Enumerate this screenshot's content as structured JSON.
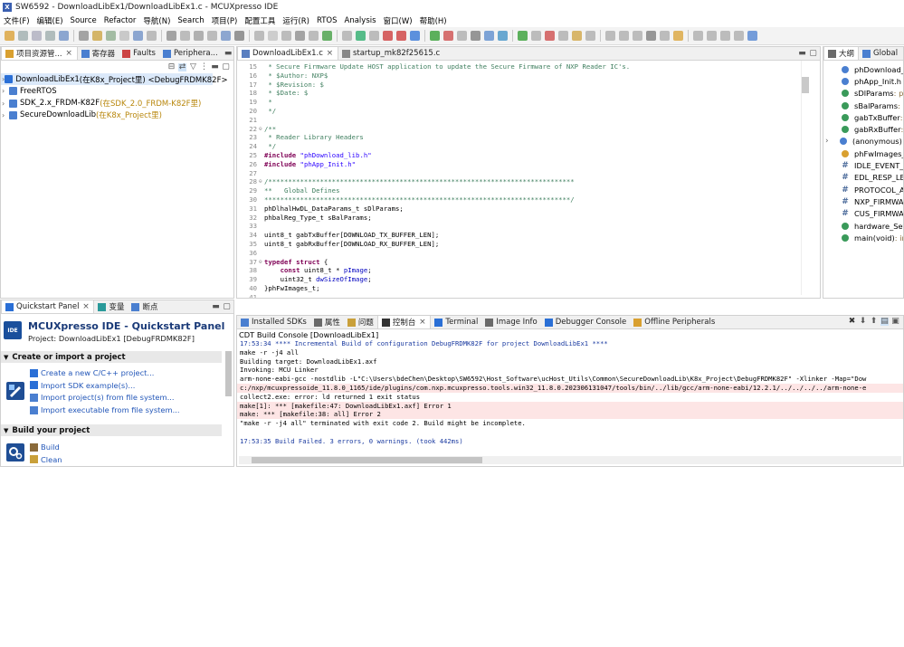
{
  "window": {
    "title": "SW6592 - DownloadLibEx1/DownloadLibEx1.c - MCUXpresso IDE"
  },
  "menu": [
    "文件(F)",
    "编辑(E)",
    "Source",
    "Refactor",
    "导航(N)",
    "Search",
    "项目(P)",
    "配置工具",
    "运行(R)",
    "RTOS",
    "Analysis",
    "窗口(W)",
    "帮助(H)"
  ],
  "explorer": {
    "tabs": [
      "项目资源管...",
      "寄存器",
      "Faults",
      "Periphera..."
    ],
    "items": [
      {
        "name": "DownloadLibEx1",
        "suffix": " (在K8x_Project里) <DebugFRDMK82F>"
      },
      {
        "name": "FreeRTOS",
        "suffix": ""
      },
      {
        "name": "SDK_2.x_FRDM-K82F",
        "suffix": " (在SDK_2.0_FRDM-K82F里)"
      },
      {
        "name": "SecureDownloadLib",
        "suffix": " (在K8x_Project里)"
      }
    ]
  },
  "editor": {
    "tabs": [
      "DownloadLibEx1.c",
      "startup_mk82f25615.c"
    ],
    "lines": [
      {
        "n": "15",
        "fold": "",
        "parts": [
          [
            "cm",
            " * Secure Firmware Update HOST application to update the Secure Firmware of NXP Reader IC's."
          ]
        ]
      },
      {
        "n": "16",
        "fold": "",
        "parts": [
          [
            "cm",
            " * $Author: NXP$"
          ]
        ]
      },
      {
        "n": "17",
        "fold": "",
        "parts": [
          [
            "cm",
            " * $Revision: $"
          ]
        ]
      },
      {
        "n": "18",
        "fold": "",
        "parts": [
          [
            "cm",
            " * $Date: $"
          ]
        ]
      },
      {
        "n": "19",
        "fold": "",
        "parts": [
          [
            "cm",
            " *"
          ]
        ]
      },
      {
        "n": "20",
        "fold": "",
        "parts": [
          [
            "cm",
            " */"
          ]
        ]
      },
      {
        "n": "21",
        "fold": "",
        "parts": [
          [
            "tx",
            ""
          ]
        ]
      },
      {
        "n": "22",
        "fold": "⊖",
        "parts": [
          [
            "cm",
            "/**"
          ]
        ]
      },
      {
        "n": "23",
        "fold": "",
        "parts": [
          [
            "cm",
            " * Reader Library Headers"
          ]
        ]
      },
      {
        "n": "24",
        "fold": "",
        "parts": [
          [
            "cm",
            " */"
          ]
        ]
      },
      {
        "n": "25",
        "fold": "",
        "parts": [
          [
            "kw",
            "#include "
          ],
          [
            "str",
            "\"phDownload_lib.h\""
          ]
        ]
      },
      {
        "n": "26",
        "fold": "",
        "parts": [
          [
            "kw",
            "#include "
          ],
          [
            "str",
            "\"phApp_Init.h\""
          ]
        ]
      },
      {
        "n": "27",
        "fold": "",
        "parts": [
          [
            "tx",
            ""
          ]
        ]
      },
      {
        "n": "28",
        "fold": "⊖",
        "parts": [
          [
            "cm",
            "/*****************************************************************************"
          ]
        ]
      },
      {
        "n": "29",
        "fold": "",
        "parts": [
          [
            "cm",
            "**   Global Defines"
          ]
        ]
      },
      {
        "n": "30",
        "fold": "",
        "parts": [
          [
            "cm",
            "*****************************************************************************/"
          ]
        ]
      },
      {
        "n": "31",
        "fold": "",
        "parts": [
          [
            "tx",
            "phDlhalHwDL_DataParams_t sDlParams;"
          ]
        ]
      },
      {
        "n": "32",
        "fold": "",
        "parts": [
          [
            "tx",
            "phbalReg_Type_t sBalParams;"
          ]
        ]
      },
      {
        "n": "33",
        "fold": "",
        "parts": [
          [
            "tx",
            ""
          ]
        ]
      },
      {
        "n": "34",
        "fold": "",
        "parts": [
          [
            "tx",
            "uint8_t gabTxBuffer[DOWNLOAD_TX_BUFFER_LEN];"
          ]
        ]
      },
      {
        "n": "35",
        "fold": "",
        "parts": [
          [
            "tx",
            "uint8_t gabRxBuffer[DOWNLOAD_RX_BUFFER_LEN];"
          ]
        ]
      },
      {
        "n": "36",
        "fold": "",
        "parts": [
          [
            "tx",
            ""
          ]
        ]
      },
      {
        "n": "37",
        "fold": "⊖",
        "parts": [
          [
            "kw",
            "typedef struct"
          ],
          [
            "tx",
            " {"
          ]
        ]
      },
      {
        "n": "38",
        "fold": "",
        "parts": [
          [
            "tx",
            "    "
          ],
          [
            "kw",
            "const"
          ],
          [
            "tx",
            " uint8_t * "
          ],
          [
            "fld",
            "pImage"
          ],
          [
            "tx",
            ";"
          ]
        ]
      },
      {
        "n": "39",
        "fold": "",
        "parts": [
          [
            "tx",
            "    uint32_t "
          ],
          [
            "fld",
            "dwSizeOfImage"
          ],
          [
            "tx",
            ";"
          ]
        ]
      },
      {
        "n": "40",
        "fold": "",
        "parts": [
          [
            "tx",
            "}phFwImages_t;"
          ]
        ]
      },
      {
        "n": "41",
        "fold": "",
        "parts": [
          [
            "tx",
            ""
          ]
        ]
      }
    ]
  },
  "outline": {
    "tabs": [
      "大纲",
      "Global"
    ],
    "items": [
      {
        "kind": "include",
        "name": "phDownload_li",
        "type": ""
      },
      {
        "kind": "include",
        "name": "phApp_Init.h",
        "type": ""
      },
      {
        "kind": "var",
        "name": "sDlParams",
        "type": " : ph"
      },
      {
        "kind": "var",
        "name": "sBalParams",
        "type": " : p"
      },
      {
        "kind": "var",
        "name": "gabTxBuffer",
        "type": " : u"
      },
      {
        "kind": "var",
        "name": "gabRxBuffer",
        "type": " : u"
      },
      {
        "kind": "anon",
        "name": "(anonymous)",
        "type": ""
      },
      {
        "kind": "type",
        "name": "phFwImages_t",
        "type": ""
      },
      {
        "kind": "macro",
        "name": "IDLE_EVENT_R",
        "type": ""
      },
      {
        "kind": "macro",
        "name": "EDL_RESP_LEN",
        "type": ""
      },
      {
        "kind": "macro",
        "name": "PROTOCOL_AR",
        "type": ""
      },
      {
        "kind": "macro",
        "name": "NXP_FIRMWAR",
        "type": ""
      },
      {
        "kind": "macro",
        "name": "CUS_FIRMWAR",
        "type": ""
      },
      {
        "kind": "func",
        "name": "hardware_Setu",
        "type": ""
      },
      {
        "kind": "func",
        "name": "main(void)",
        "type": " : int"
      }
    ]
  },
  "quickstart": {
    "tabs": [
      "Quickstart Panel",
      "变量",
      "断点"
    ],
    "title": "MCUXpresso IDE - Quickstart Panel",
    "project": "Project: DownloadLibEx1 [DebugFRDMK82F]",
    "section1": "Create or import a project",
    "links1": [
      "Create a new C/C++ project...",
      "Import SDK example(s)...",
      "Import project(s) from file system...",
      "Import executable from file system..."
    ],
    "section2": "Build your project",
    "links2": [
      "Build",
      "Clean"
    ]
  },
  "console": {
    "tabs": [
      "Installed SDKs",
      "属性",
      "问题",
      "控制台",
      "Terminal",
      "Image Info",
      "Debugger Console",
      "Offline Peripherals"
    ],
    "header": "CDT Build Console [DownloadLibEx1]",
    "lines": [
      {
        "style": "blue",
        "text": "17:53:34 **** Incremental Build of configuration DebugFRDMK82F for project DownloadLibEx1 ****"
      },
      {
        "style": "",
        "text": "make -r -j4 all"
      },
      {
        "style": "",
        "text": "Building target: DownloadLibEx1.axf"
      },
      {
        "style": "",
        "text": "Invoking: MCU Linker"
      },
      {
        "style": "",
        "text": "arm-none-eabi-gcc -nostdlib -L\"C:\\Users\\bdeChen\\Desktop\\SW6592\\Host_Software\\ucHost_Utils\\Common\\SecureDownloadLib\\K8x_Project\\DebugFRDMK82F\" -Xlinker -Map=\"Dow"
      },
      {
        "style": "err",
        "text": "c:/nxp/mcuxpressoide_11.8.0_1165/ide/plugins/com.nxp.mcuxpresso.tools.win32_11.8.0.202306131047/tools/bin/../lib/gcc/arm-none-eabi/12.2.1/../../../../arm-none-e"
      },
      {
        "style": "",
        "text": "collect2.exe: error: ld returned 1 exit status"
      },
      {
        "style": "err",
        "text": "make[1]: *** [makefile:47: DownloadLibEx1.axf] Error 1"
      },
      {
        "style": "err",
        "text": "make: *** [makefile:38: all] Error 2"
      },
      {
        "style": "",
        "text": "\"make -r -j4 all\" terminated with exit code 2. Build might be incomplete."
      },
      {
        "style": "",
        "text": ""
      },
      {
        "style": "blue",
        "text": "17:53:35 Build Failed. 3 errors, 0 warnings. (took 442ms)"
      }
    ]
  },
  "colors": {
    "accent": "#2256b8",
    "error_bg": "#fde5e5",
    "comment": "#3f7f5f",
    "keyword": "#7f0055"
  }
}
